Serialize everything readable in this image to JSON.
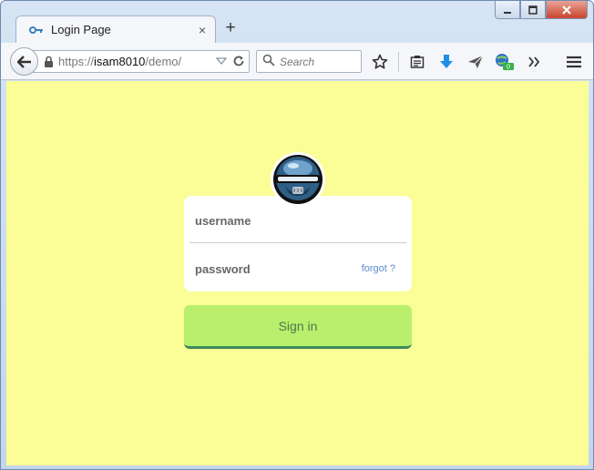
{
  "window": {
    "controls": {
      "minimize": "_",
      "maximize": "□",
      "close": "✕"
    }
  },
  "tab": {
    "title": "Login Page",
    "close": "×",
    "new_tab": "+",
    "icon": "key-icon"
  },
  "navbar": {
    "url_prefix": "https://",
    "url_host": "isam8010",
    "url_path": "/demo/",
    "search_placeholder": "Search",
    "icons": [
      "bookmark-star-icon",
      "reading-list-icon",
      "download-icon",
      "send-icon",
      "globe-badge-icon",
      "overflow-chevron-icon",
      "hamburger-menu-icon"
    ],
    "badge_count": "0"
  },
  "login": {
    "username_placeholder": "username",
    "password_placeholder": "password",
    "forgot_label": "forgot ?",
    "signin_label": "Sign in"
  },
  "colors": {
    "page_background": "#fbfd97",
    "signin_button": "#b9ef6d",
    "signin_border": "#3f8a5a",
    "forgot_link": "#5b8ed0"
  }
}
